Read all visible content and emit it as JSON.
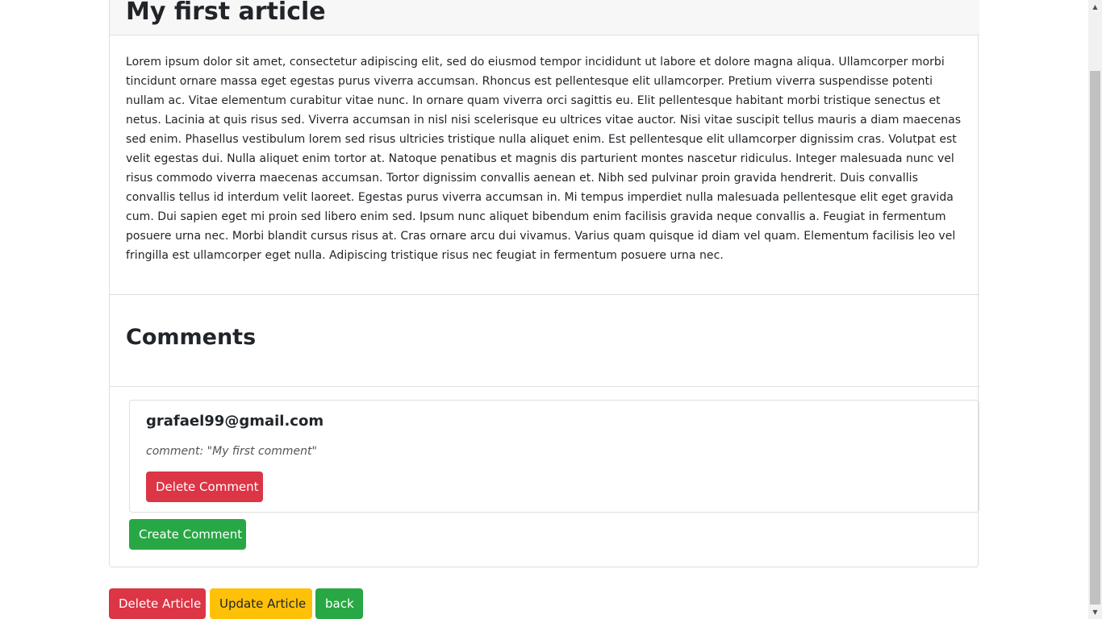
{
  "article": {
    "title": "My first article",
    "body": "Lorem ipsum dolor sit amet, consectetur adipiscing elit, sed do eiusmod tempor incididunt ut labore et dolore magna aliqua. Ullamcorper morbi tincidunt ornare massa eget egestas purus viverra accumsan. Rhoncus est pellentesque elit ullamcorper. Pretium viverra suspendisse potenti nullam ac. Vitae elementum curabitur vitae nunc. In ornare quam viverra orci sagittis eu. Elit pellentesque habitant morbi tristique senectus et netus. Lacinia at quis risus sed. Viverra accumsan in nisl nisi scelerisque eu ultrices vitae auctor. Nisi vitae suscipit tellus mauris a diam maecenas sed enim. Phasellus vestibulum lorem sed risus ultricies tristique nulla aliquet enim. Est pellentesque elit ullamcorper dignissim cras. Volutpat est velit egestas dui. Nulla aliquet enim tortor at. Natoque penatibus et magnis dis parturient montes nascetur ridiculus. Integer malesuada nunc vel risus commodo viverra maecenas accumsan. Tortor dignissim convallis aenean et. Nibh sed pulvinar proin gravida hendrerit. Duis convallis convallis tellus id interdum velit laoreet. Egestas purus viverra accumsan in. Mi tempus imperdiet nulla malesuada pellentesque elit eget gravida cum. Dui sapien eget mi proin sed libero enim sed. Ipsum nunc aliquet bibendum enim facilisis gravida neque convallis a. Feugiat in fermentum posuere urna nec. Morbi blandit cursus risus at. Cras ornare arcu dui vivamus. Varius quam quisque id diam vel quam. Elementum facilisis leo vel fringilla est ullamcorper eget nulla. Adipiscing tristique risus nec feugiat in fermentum posuere urna nec."
  },
  "comments_section": {
    "heading": "Comments",
    "items": [
      {
        "author": "grafael99@gmail.com",
        "text": "comment: \"My first comment\"",
        "delete_label": "Delete Comment"
      }
    ],
    "create_label": "Create Comment"
  },
  "actions": {
    "delete_label": "Delete Article",
    "update_label": "Update Article",
    "back_label": "back"
  },
  "colors": {
    "danger": "#dc3545",
    "success": "#28a745",
    "warning": "#ffc107"
  },
  "icons": {
    "scroll_up": "arrow-up-icon",
    "scroll_down": "arrow-down-icon"
  }
}
